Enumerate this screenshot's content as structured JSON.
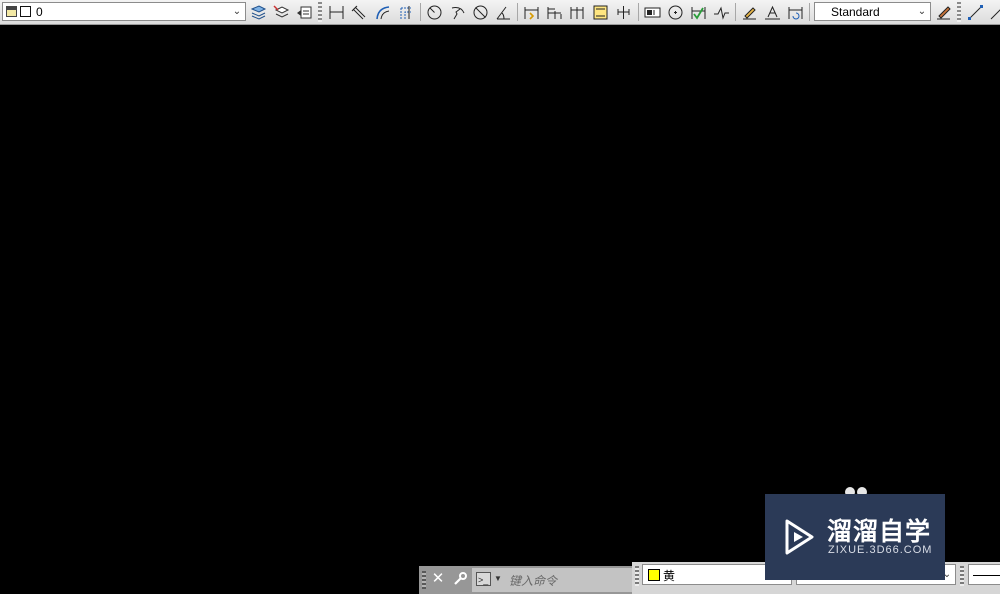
{
  "toolbar": {
    "layer_name": "0",
    "text_style": "Standard"
  },
  "command_line": {
    "placeholder": "键入命令"
  },
  "properties": {
    "color_name": "黄",
    "color_swatch": "#ffff00"
  },
  "watermark": {
    "title": "溜溜自学",
    "url": "ZIXUE.3D66.COM"
  }
}
